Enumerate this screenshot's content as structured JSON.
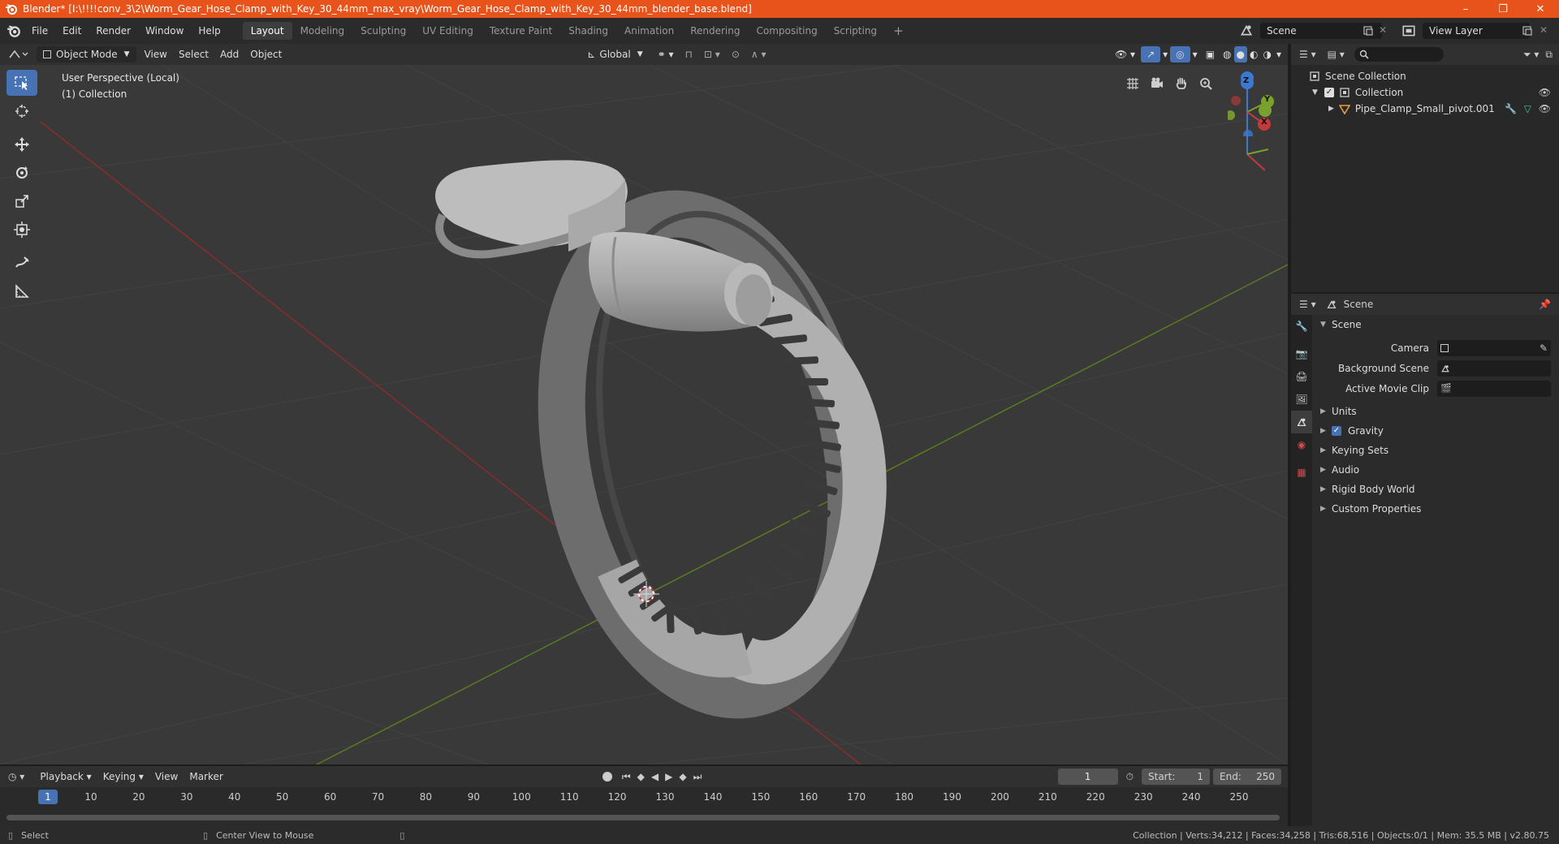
{
  "window": {
    "title": "Blender* [I:\\!!!!conv_3\\2\\Worm_Gear_Hose_Clamp_with_Key_30_44mm_max_vray\\Worm_Gear_Hose_Clamp_with_Key_30_44mm_blender_base.blend]",
    "minimize": "–",
    "maximize": "❐",
    "close": "✕"
  },
  "menu": [
    "File",
    "Edit",
    "Render",
    "Window",
    "Help"
  ],
  "workspaces": [
    "Layout",
    "Modeling",
    "Sculpting",
    "UV Editing",
    "Texture Paint",
    "Shading",
    "Animation",
    "Rendering",
    "Compositing",
    "Scripting"
  ],
  "workspace_add": "+",
  "scene_name": "Scene",
  "view_layer": "View Layer",
  "viewport_header": {
    "mode": "Object Mode",
    "menus": [
      "View",
      "Select",
      "Add",
      "Object"
    ],
    "transform": "Global"
  },
  "viewport": {
    "perspective": "User Perspective (Local)",
    "collection": "(1) Collection",
    "axes": {
      "z": "Z",
      "y": "Y",
      "x": "X"
    }
  },
  "outliner": {
    "root": "Scene Collection",
    "collection": "Collection",
    "object": "Pipe_Clamp_Small_pivot.001"
  },
  "properties": {
    "context": "Scene",
    "panel": "Scene",
    "rows": [
      {
        "label": "Camera"
      },
      {
        "label": "Background Scene"
      },
      {
        "label": "Active Movie Clip"
      }
    ],
    "subpanels": [
      "Units",
      "Gravity",
      "Keying Sets",
      "Audio",
      "Rigid Body World",
      "Custom Properties"
    ]
  },
  "timeline": {
    "menus": [
      "Playback",
      "Keying",
      "View",
      "Marker"
    ],
    "current_frame": "1",
    "start_label": "Start:",
    "start": "1",
    "end_label": "End:",
    "end": "250",
    "ruler": [
      "1",
      "10",
      "20",
      "30",
      "40",
      "50",
      "60",
      "70",
      "80",
      "90",
      "100",
      "110",
      "120",
      "130",
      "140",
      "150",
      "160",
      "170",
      "180",
      "190",
      "200",
      "210",
      "220",
      "230",
      "240",
      "250"
    ]
  },
  "status": {
    "left": "Select",
    "middle": "Center View to Mouse",
    "right": "Collection | Verts:34,212 | Faces:34,258 | Tris:68,516 | Objects:0/1 | Mem: 35.5 MB | v2.80.75"
  },
  "colors": {
    "title_bar": "#e8531c",
    "accent": "#4772b3",
    "x_axis": "#c23a3a",
    "y_axis": "#7aa12d",
    "z_axis": "#3c79d1"
  }
}
